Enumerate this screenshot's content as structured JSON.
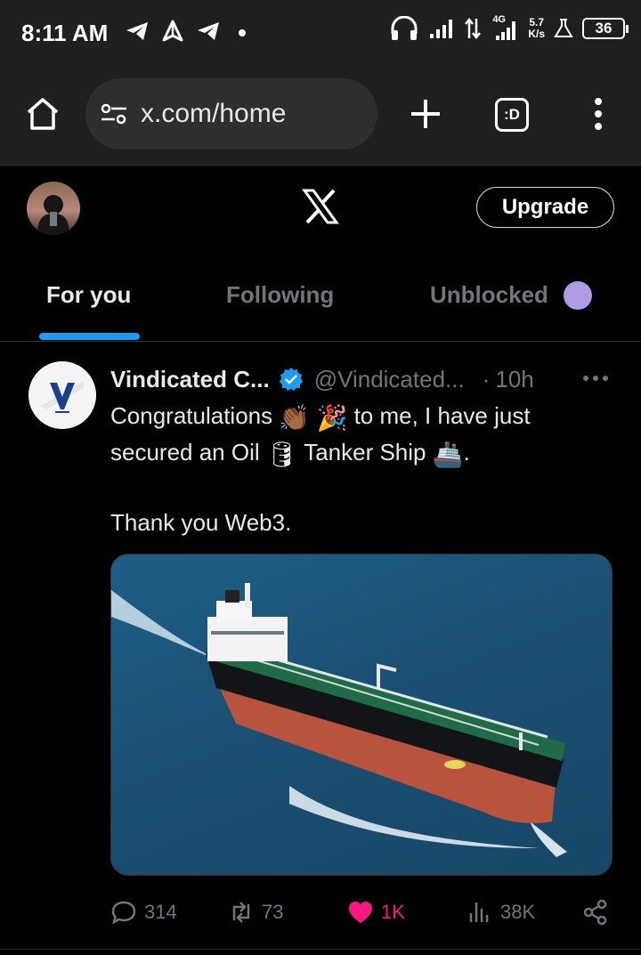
{
  "status_bar": {
    "time": "8:11 AM",
    "network_type": "4G",
    "speed_value": "5.7",
    "speed_unit": "K/s",
    "battery": "36"
  },
  "browser": {
    "url": "x.com/home",
    "tabs_label": ":D"
  },
  "x_header": {
    "upgrade_label": "Upgrade",
    "tabs": [
      {
        "label": "For you",
        "active": true
      },
      {
        "label": "Following",
        "active": false
      },
      {
        "label": "Unblocked",
        "active": false
      }
    ],
    "accent_color": "#1d9bf0",
    "unblocked_dot_color": "#b19ae6"
  },
  "tweet": {
    "author_name": "Vindicated C...",
    "author_handle": "@Vindicated...",
    "separator": "·",
    "time": "10h",
    "body": {
      "line1_before": "Congratulations",
      "line1_after": "to me, I have just",
      "line2_before": "secured an Oil",
      "line2_mid": "Tanker Ship",
      "line2_end": ".",
      "line3": "Thank you Web3."
    },
    "emojis": [
      "clapping-hands",
      "party-popper",
      "oil-drum",
      "ship"
    ],
    "avatar_logo_text": "V",
    "media_description_icon": "oil-tanker-ship-image",
    "actions": {
      "replies": "314",
      "reposts": "73",
      "likes": "1K",
      "views": "38K"
    },
    "like_color": "#f91880",
    "verified_color": "#1d9bf0"
  }
}
